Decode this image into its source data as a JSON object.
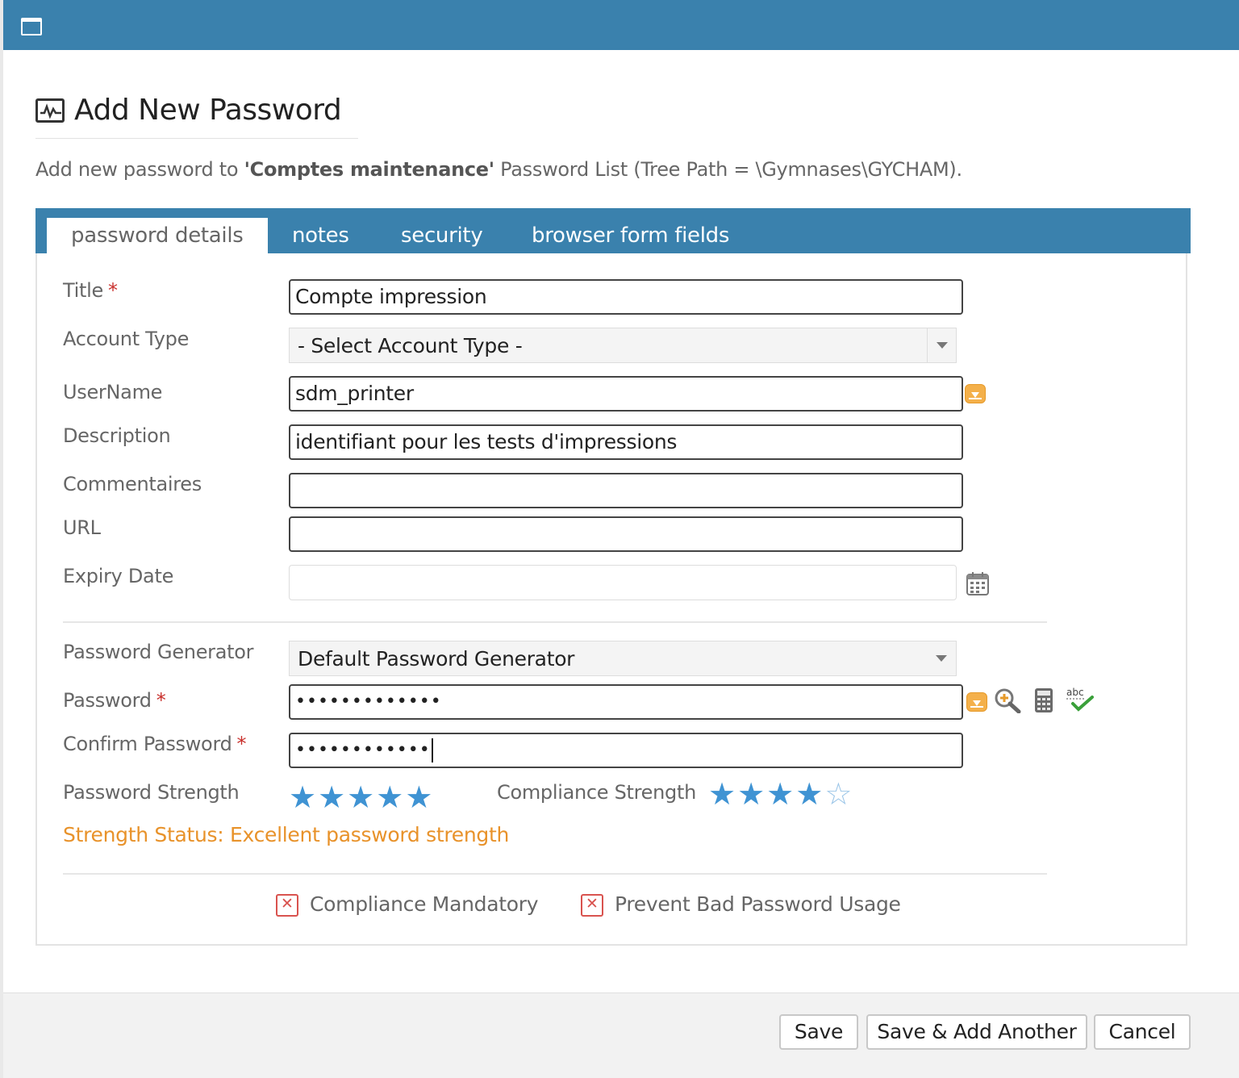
{
  "dialog": {
    "title": "Add New Password",
    "intro_prefix": "Add new password to ",
    "intro_list": "'Comptes maintenance'",
    "intro_suffix": " Password List (Tree Path = \\Gymnases\\GYCHAM)."
  },
  "tabs": [
    {
      "label": "password details",
      "active": true
    },
    {
      "label": "notes",
      "active": false
    },
    {
      "label": "security",
      "active": false
    },
    {
      "label": "browser form fields",
      "active": false
    }
  ],
  "form": {
    "title": {
      "label": "Title",
      "required": "*",
      "value": "Compte impression"
    },
    "account_type": {
      "label": "Account Type",
      "value": "- Select Account Type -"
    },
    "username": {
      "label": "UserName",
      "value": "sdm_printer"
    },
    "description": {
      "label": "Description",
      "value": "identifiant pour les tests d'impressions"
    },
    "commentaires": {
      "label": "Commentaires",
      "value": ""
    },
    "url": {
      "label": "URL",
      "value": ""
    },
    "expiry_date": {
      "label": "Expiry Date",
      "value": ""
    },
    "password_generator": {
      "label": "Password Generator",
      "value": "Default Password Generator"
    },
    "password": {
      "label": "Password",
      "required": "*",
      "value": "•••••••••••••"
    },
    "confirm_password": {
      "label": "Confirm Password",
      "required": "*",
      "value": "••••••••••••"
    },
    "password_strength": {
      "label": "Password Strength",
      "stars": 5,
      "max": 5
    },
    "compliance_strength": {
      "label": "Compliance Strength",
      "stars": 4,
      "max": 5
    },
    "strength_status": "Strength Status: Excellent password strength",
    "compliance_mandatory": {
      "label": "Compliance Mandatory",
      "checked": false
    },
    "prevent_bad_usage": {
      "label": "Prevent Bad Password Usage",
      "checked": false
    }
  },
  "icons": {
    "window": "window-icon",
    "heading": "activity-chart-icon",
    "username_action": "download-icon",
    "calendar": "calendar-icon",
    "password_action": "download-icon",
    "search": "magnifier-plus-icon",
    "calculator": "calculator-icon",
    "spellcheck": "abc-check-icon"
  },
  "footer": {
    "save": "Save",
    "save_add": "Save & Add Another",
    "cancel": "Cancel"
  },
  "colors": {
    "header_blue": "#3a81ad",
    "required_red": "#c9302c",
    "status_orange": "#e8922a",
    "star_blue": "#3f93d3"
  }
}
